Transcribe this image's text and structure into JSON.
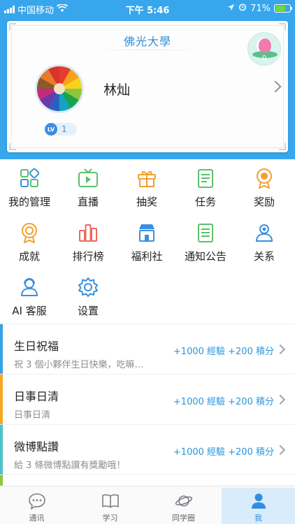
{
  "status_bar": {
    "carrier": "中国移动",
    "time": "下午 5:46",
    "battery": "71%",
    "battery_level": 0.71
  },
  "profile": {
    "school": "佛光大學",
    "name": "林灿",
    "lotus_count": "0",
    "level_badge": "LV",
    "level": "1"
  },
  "menu": {
    "items": [
      {
        "label": "我的管理",
        "icon": "grid-manage-icon"
      },
      {
        "label": "直播",
        "icon": "tv-icon"
      },
      {
        "label": "抽奖",
        "icon": "gift-icon"
      },
      {
        "label": "任务",
        "icon": "task-list-icon"
      },
      {
        "label": "奖励",
        "icon": "award-medal-icon"
      },
      {
        "label": "成就",
        "icon": "achievement-medal-icon"
      },
      {
        "label": "排行榜",
        "icon": "ranking-bars-icon"
      },
      {
        "label": "福利社",
        "icon": "store-icon"
      },
      {
        "label": "通知公告",
        "icon": "notice-icon"
      },
      {
        "label": "关系",
        "icon": "relations-icon"
      },
      {
        "label": "AI 客服",
        "icon": "ai-service-icon"
      },
      {
        "label": "设置",
        "icon": "gear-icon"
      }
    ]
  },
  "tasks": [
    {
      "title": "生日祝福",
      "desc": "祝 3 個小夥伴生日快樂，吃嘛…",
      "reward": "+1000 經驗 +200 積分",
      "accent": "#3aa0e8"
    },
    {
      "title": "日事日清",
      "desc": "日事日清",
      "reward": "+1000 經驗 +200 積分",
      "accent": "#f5a623"
    },
    {
      "title": "微博點讚",
      "desc": "給 3 條微博點讚有獎勵哦！",
      "reward": "+1000 經驗 +200 積分",
      "accent": "#4cc3c9"
    }
  ],
  "tabbar": {
    "tabs": [
      {
        "label": "通讯",
        "icon": "chat-bubble-icon"
      },
      {
        "label": "学习",
        "icon": "book-icon"
      },
      {
        "label": "同学圈",
        "icon": "planet-icon"
      },
      {
        "label": "我",
        "icon": "person-icon",
        "active": true
      }
    ]
  },
  "colors": {
    "header_blue": "#37a6ec",
    "icon_green": "#5cbf6a",
    "icon_blue": "#3a8fe0",
    "icon_orange": "#f2a030",
    "icon_red": "#e86a5e",
    "reward_blue": "#2b95db"
  }
}
